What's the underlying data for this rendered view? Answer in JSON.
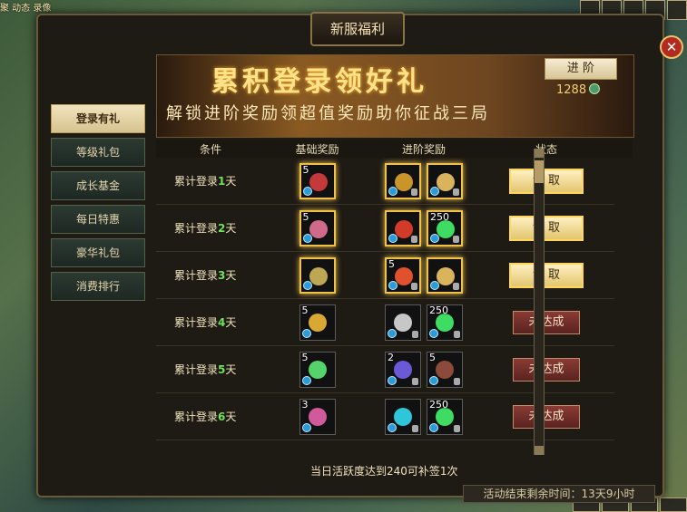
{
  "top_left_text": "聚 动态 录像",
  "window": {
    "title": "新服福利",
    "close_label": "✕"
  },
  "sidebar": {
    "items": [
      {
        "label": "登录有礼",
        "active": true
      },
      {
        "label": "等级礼包"
      },
      {
        "label": "成长基金"
      },
      {
        "label": "每日特惠"
      },
      {
        "label": "豪华礼包"
      },
      {
        "label": "消费排行"
      }
    ]
  },
  "banner": {
    "title": "累积登录领好礼",
    "subtitle": "解锁进阶奖励领超值奖励助你征战三局",
    "advance_label": "进 阶",
    "points": "1288"
  },
  "table": {
    "headers": [
      "条件",
      "基础奖励",
      "进阶奖励",
      "状态"
    ],
    "rows": [
      {
        "prefix": "累计登录",
        "day": "1",
        "suffix": "天",
        "basic": {
          "qty": "5",
          "color": "#c43a3a"
        },
        "adv1": {
          "qty": "",
          "color": "#c9952a"
        },
        "adv2": {
          "qty": "",
          "color": "#d9b45c"
        },
        "status": "领 取"
      },
      {
        "prefix": "累计登录",
        "day": "2",
        "suffix": "天",
        "basic": {
          "qty": "5",
          "color": "#d06a8a"
        },
        "adv1": {
          "qty": "",
          "color": "#d23b2a"
        },
        "adv2": {
          "qty": "250",
          "color": "#3fdc63"
        },
        "status": "领 取"
      },
      {
        "prefix": "累计登录",
        "day": "3",
        "suffix": "天",
        "basic": {
          "qty": "",
          "color": "#bda752"
        },
        "adv1": {
          "qty": "5",
          "color": "#e0522e"
        },
        "adv2": {
          "qty": "",
          "color": "#d9b45c"
        },
        "status": "领 取"
      },
      {
        "prefix": "累计登录",
        "day": "4",
        "suffix": "天",
        "basic": {
          "qty": "5",
          "color": "#d9a832"
        },
        "adv1": {
          "qty": "",
          "color": "#c7c7c7"
        },
        "adv2": {
          "qty": "250",
          "color": "#3fdc63"
        },
        "status": "未达成"
      },
      {
        "prefix": "累计登录",
        "day": "5",
        "suffix": "天",
        "basic": {
          "qty": "5",
          "color": "#56d36b"
        },
        "adv1": {
          "qty": "2",
          "color": "#6a5ad8"
        },
        "adv2": {
          "qty": "5",
          "color": "#8b4a3a"
        },
        "status": "未达成"
      },
      {
        "prefix": "累计登录",
        "day": "6",
        "suffix": "天",
        "basic": {
          "qty": "3",
          "color": "#d05a9a"
        },
        "adv1": {
          "qty": "",
          "color": "#2ec6d8"
        },
        "adv2": {
          "qty": "250",
          "color": "#3fdc63"
        },
        "status": "未达成"
      }
    ]
  },
  "footer": {
    "note": "当日活跃度达到240可补签1次",
    "timer": "活动结束剩余时间：13天9小时"
  }
}
